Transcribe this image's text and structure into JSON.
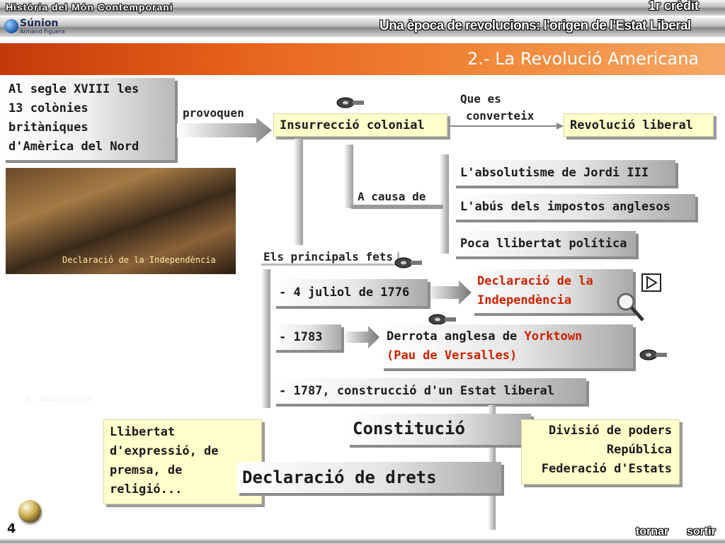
{
  "header": {
    "course": "Història del Món Contemporani",
    "credit": "1r crèdit",
    "logo_text": "Súnion",
    "logo_sub": "Armand Figuera",
    "unit_title": "Una època de revolucions: l'origen de l'Estat Liberal"
  },
  "section_title": "2.- La Revolució Americana",
  "intro_box": [
    "Al segle XVIII les",
    "13 colònies",
    "britàniques",
    "d'Amèrica del Nord"
  ],
  "picture_caption": "Declaració de la Independència",
  "washington_caption": "G. Washington",
  "labels": {
    "provoquen": "provoquen",
    "que_es_1": "Que es",
    "que_es_2": "converteix",
    "a_causa_de": "A causa de",
    "principals_fets": "Els principals fets"
  },
  "boxes": {
    "insurreccio": "Insurrecció colonial",
    "revolucio": "Revolució liberal",
    "absolutisme": "L'absolutisme de Jordi III",
    "abus": "L'abús dels impostos anglesos",
    "llibertat": "Poca llibertat política",
    "fet1": "- 4 juliol de 1776",
    "declaracio_1": "Declaració de la",
    "declaracio_2": "Independència",
    "fet2": "- 1783",
    "derrota_1a": "Derrota anglesa de ",
    "derrota_1b": "Yorktown",
    "derrota_2": "(Pau de Versalles)",
    "fet3": "- 1787, construcció d'un Estat liberal",
    "constitucio": "Constitució",
    "declaracio_drets": "Declaració de drets",
    "llibertats": [
      "Llibertat",
      "d'expressió, de",
      "premsa, de",
      "religió..."
    ],
    "poders": [
      "Divisió de poders",
      "República",
      "Federació d'Estats"
    ]
  },
  "footer": {
    "page_number": "4",
    "tornar": "tornar",
    "sortir": "sortir"
  },
  "colors": {
    "orange": "#e8651c",
    "yellow_box": "#ffffcc",
    "red_text": "#cc2200"
  },
  "icons": [
    "film-reel-icon",
    "magnifier-icon",
    "play-icon",
    "sphere-button-icon"
  ]
}
